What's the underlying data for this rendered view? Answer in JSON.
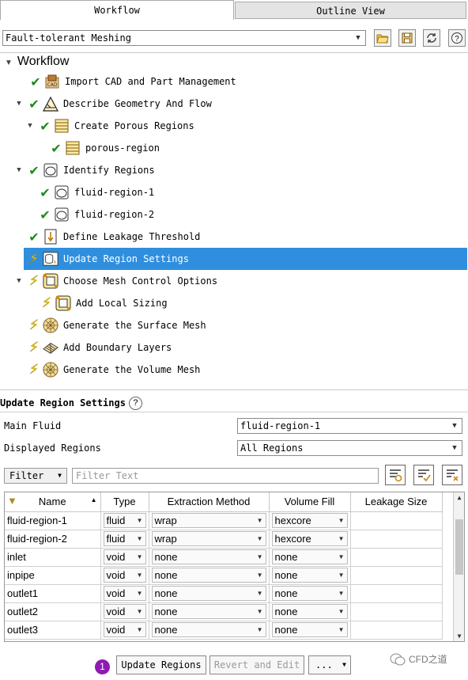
{
  "tabs": [
    {
      "label": "Workflow",
      "active": true
    },
    {
      "label": "Outline View",
      "active": false
    }
  ],
  "workflow_select": {
    "value": "Fault-tolerant Meshing"
  },
  "toolbar_icons": [
    "open-folder-icon",
    "save-icon",
    "refresh-icon",
    "help-icon"
  ],
  "tree": {
    "title": "Workflow",
    "nodes": [
      {
        "label": "Import CAD and Part Management",
        "status": "done",
        "icon": "cad-import-icon"
      },
      {
        "label": "Describe Geometry And Flow",
        "status": "done",
        "icon": "geometry-icon"
      },
      {
        "label": "Create Porous Regions",
        "status": "done",
        "icon": "porous-icon"
      },
      {
        "label": "porous-region",
        "status": "done",
        "icon": "porous-icon"
      },
      {
        "label": "Identify Regions",
        "status": "done",
        "icon": "region-icon"
      },
      {
        "label": "fluid-region-1",
        "status": "done",
        "icon": "region-icon"
      },
      {
        "label": "fluid-region-2",
        "status": "done",
        "icon": "region-icon"
      },
      {
        "label": "Define Leakage Threshold",
        "status": "done",
        "icon": "leakage-icon"
      },
      {
        "label": "Update Region Settings",
        "status": "pending",
        "icon": "region-settings-icon",
        "selected": true
      },
      {
        "label": "Choose Mesh Control Options",
        "status": "pending",
        "icon": "mesh-control-icon"
      },
      {
        "label": "Add Local Sizing",
        "status": "pending",
        "icon": "local-sizing-icon"
      },
      {
        "label": "Generate the Surface Mesh",
        "status": "pending",
        "icon": "surface-mesh-icon"
      },
      {
        "label": "Add Boundary Layers",
        "status": "pending",
        "icon": "boundary-layer-icon"
      },
      {
        "label": "Generate the Volume Mesh",
        "status": "pending",
        "icon": "volume-mesh-icon"
      }
    ]
  },
  "panel": {
    "title": "Update Region Settings",
    "main_fluid_label": "Main Fluid",
    "main_fluid_value": "fluid-region-1",
    "displayed_regions_label": "Displayed Regions",
    "displayed_regions_value": "All Regions",
    "filter_label": "Filter",
    "filter_placeholder": "Filter Text"
  },
  "table": {
    "columns": [
      "Name",
      "Type",
      "Extraction Method",
      "Volume Fill",
      "Leakage Size"
    ],
    "rows": [
      {
        "name": "fluid-region-1",
        "type": "fluid",
        "extraction": "wrap",
        "fill": "hexcore",
        "leakage": ""
      },
      {
        "name": "fluid-region-2",
        "type": "fluid",
        "extraction": "wrap",
        "fill": "hexcore",
        "leakage": ""
      },
      {
        "name": "inlet",
        "type": "void",
        "extraction": "none",
        "fill": "none",
        "leakage": ""
      },
      {
        "name": "inpipe",
        "type": "void",
        "extraction": "none",
        "fill": "none",
        "leakage": ""
      },
      {
        "name": "outlet1",
        "type": "void",
        "extraction": "none",
        "fill": "none",
        "leakage": ""
      },
      {
        "name": "outlet2",
        "type": "void",
        "extraction": "none",
        "fill": "none",
        "leakage": ""
      },
      {
        "name": "outlet3",
        "type": "void",
        "extraction": "none",
        "fill": "none",
        "leakage": ""
      }
    ]
  },
  "buttons": {
    "update": "Update Regions",
    "revert": "Revert and Edit",
    "more": "..."
  },
  "badge": "1",
  "watermark": "CFD之道",
  "colors": {
    "selection": "#2f8fde",
    "check": "#1d8a1d",
    "bolt": "#f2d600",
    "badge": "#8e1bb3"
  }
}
